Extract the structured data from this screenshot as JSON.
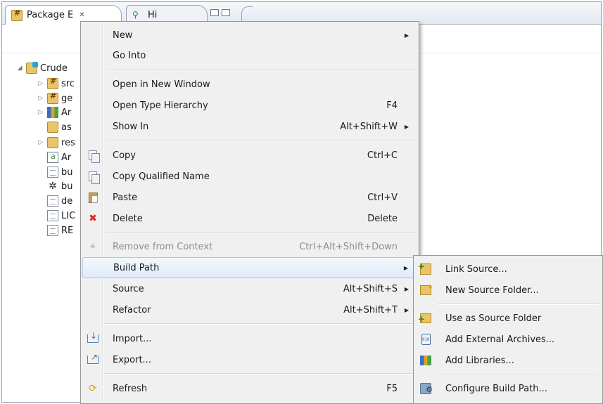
{
  "explorer": {
    "tabs": [
      {
        "label": "Package E",
        "close": "✕"
      },
      {
        "label": "Hi"
      }
    ],
    "tree": [
      {
        "label": "Crude",
        "icon": "project-icon"
      },
      {
        "label": "src",
        "icon": "package-folder-icon"
      },
      {
        "label": "ge",
        "icon": "package-folder-icon"
      },
      {
        "label": "Ar",
        "icon": "library-icon"
      },
      {
        "label": "as",
        "icon": "folder-icon"
      },
      {
        "label": "res",
        "icon": "folder-icon"
      },
      {
        "label": "Ar",
        "icon": "android-manifest-icon"
      },
      {
        "label": "bu",
        "icon": "file-icon"
      },
      {
        "label": "bu",
        "icon": "bug-icon"
      },
      {
        "label": "de",
        "icon": "file-icon"
      },
      {
        "label": "LIC",
        "icon": "file-icon"
      },
      {
        "label": "RE",
        "icon": "file-icon"
      }
    ]
  },
  "context_menu": {
    "items": [
      {
        "label": "New",
        "submenu": true
      },
      {
        "label": "Go Into"
      },
      {
        "label": "Open in New Window"
      },
      {
        "label": "Open Type Hierarchy",
        "shortcut": "F4"
      },
      {
        "label": "Show In",
        "shortcut": "Alt+Shift+W",
        "submenu": true
      },
      {
        "label": "Copy",
        "shortcut": "Ctrl+C",
        "icon": "copy-icon"
      },
      {
        "label": "Copy Qualified Name",
        "icon": "copy-qualified-name-icon"
      },
      {
        "label": "Paste",
        "shortcut": "Ctrl+V",
        "icon": "paste-icon"
      },
      {
        "label": "Delete",
        "shortcut": "Delete",
        "icon": "delete-icon"
      },
      {
        "label": "Remove from Context",
        "shortcut": "Ctrl+Alt+Shift+Down",
        "icon": "remove-from-context-icon",
        "disabled": true
      },
      {
        "label": "Build Path",
        "submenu": true,
        "highlighted": true
      },
      {
        "label": "Source",
        "shortcut": "Alt+Shift+S",
        "submenu": true
      },
      {
        "label": "Refactor",
        "shortcut": "Alt+Shift+T",
        "submenu": true
      },
      {
        "label": "Import...",
        "icon": "import-icon"
      },
      {
        "label": "Export...",
        "icon": "export-icon"
      },
      {
        "label": "Refresh",
        "shortcut": "F5",
        "icon": "refresh-icon"
      }
    ],
    "submenu_arrow": "▶"
  },
  "build_path_submenu": {
    "items": [
      {
        "label": "Link Source...",
        "icon": "link-source-icon"
      },
      {
        "label": "New Source Folder...",
        "icon": "new-source-folder-icon"
      },
      {
        "label": "Use as Source Folder",
        "icon": "use-as-source-folder-icon"
      },
      {
        "label": "Add External Archives...",
        "icon": "external-archive-icon"
      },
      {
        "label": "Add Libraries...",
        "icon": "libraries-icon"
      },
      {
        "label": "Configure Build Path...",
        "icon": "configure-build-path-icon"
      }
    ]
  },
  "colors": {
    "menu_bg": "#f0f0f0",
    "highlight_bg": "#dfecfa",
    "highlight_border": "#a8c8ec",
    "disabled_text": "#8d8d8d",
    "delete_icon": "#d62626"
  }
}
